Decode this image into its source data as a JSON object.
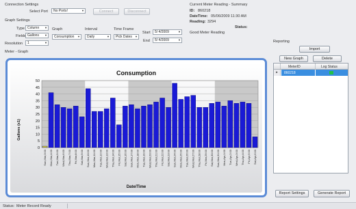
{
  "connection": {
    "title": "Connection Settings",
    "select_port_label": "Select Port",
    "port_value": "No Ports!",
    "connect_label": "Connect",
    "disconnect_label": "Disconnect"
  },
  "graph_settings": {
    "title": "Graph Settings",
    "type_label": "Type",
    "type_value": "Column",
    "fields_label": "Fields",
    "fields_value": "Gallons",
    "resolution_label": "Resolution",
    "resolution_value": "1",
    "graph_label": "Graph",
    "graph_value": "Consumption",
    "interval_label": "Interval",
    "interval_value": "Daily",
    "timeframe_label": "Time Frame",
    "timeframe_value": "Pick Dates",
    "start_label": "Start",
    "start_value": "5/ 4/2009",
    "end_label": "End",
    "end_value": "5/ 4/2009"
  },
  "meter_reading": {
    "title": "Current Meter Reading - Summary",
    "id_label": "ID:",
    "id_value": "860218",
    "datetime_label": "DateTime:",
    "datetime_value": "05/06/2009 11:30 AM",
    "reading_label": "Reading:",
    "reading_value": "3294",
    "status_label": "Status:",
    "status_value": "Good Meter Reading"
  },
  "meter_graph_label": "Meter - Graph",
  "reporting": {
    "title": "Reporting",
    "import_label": "Import",
    "new_graph_label": "New Graph",
    "delete_label": "Delete",
    "columns": [
      "MeterID",
      "Log Status"
    ],
    "rows": [
      {
        "marker": "▸",
        "meter_id": "860218",
        "status_color": "#21c24a"
      }
    ],
    "report_settings_label": "Report Settings",
    "generate_report_label": "Generate Report"
  },
  "status_bar": {
    "label": "Status:",
    "value": "Meter Record Ready"
  },
  "colors": {
    "bar": "#1a1ad6",
    "bar_edge": "#00006e",
    "first_bar": "#e8e02a",
    "band": "#c9c9c9",
    "chart_border": "#5b8bd6",
    "selected_row": "#3a8ee0"
  },
  "chart_data": {
    "type": "bar",
    "title": "Consumption",
    "xlabel": "Date/Time",
    "ylabel": "Gallons (x1)",
    "ylim": [
      0,
      50
    ],
    "yticks": [
      0,
      5,
      10,
      15,
      20,
      25,
      30,
      35,
      40,
      45,
      50
    ],
    "grid": true,
    "categories": [
      "Sun,Mar,3:00",
      "Mon,Mar,4:00",
      "Tue,Mar,5:00",
      "Wed,Mar,6:00",
      "Thu,Mar,7:00",
      "Fri,Mar,8:00",
      "Sat,Mar,9:00",
      "Sun,Mar,10:00",
      "Mon,Mar,11:00",
      "Tue,Mar,12:00",
      "Wed,Mar,13:00",
      "Thu,Mar,14:00",
      "Fri,Mar,15:00",
      "Sat,Mar,16:00",
      "Sun,Mar,17:00",
      "Mon,Mar,18:00",
      "Tue,Mar,19:00",
      "Wed,Mar,20:00",
      "Thu,Mar,21:00",
      "Fri,Mar,22:00",
      "Sat,Mar,23:00",
      "Sun,Mar,24:00",
      "Mon,Mar,25:00",
      "Tue,Mar,26:00",
      "Wed,Mar,27:00",
      "Thu,Mar,28:00",
      "Fri,Mar,29:00",
      "Sat,Mar,30:00",
      "Sun,Mar,31:00",
      "Mon,Apr,1:00",
      "Tue,Apr,2:00",
      "Wed,Apr,3:00",
      "Thu,Apr,4:00",
      "Fri,Apr,5:00",
      "Sat,Apr,6:00"
    ],
    "values": [
      1,
      41,
      32,
      30,
      29,
      31,
      23,
      44,
      27,
      27,
      29,
      37,
      17,
      31,
      32,
      29,
      31,
      32,
      34,
      37,
      30,
      48,
      36,
      38,
      39,
      30,
      30,
      33,
      34,
      31,
      35,
      33,
      34,
      33,
      8
    ]
  }
}
